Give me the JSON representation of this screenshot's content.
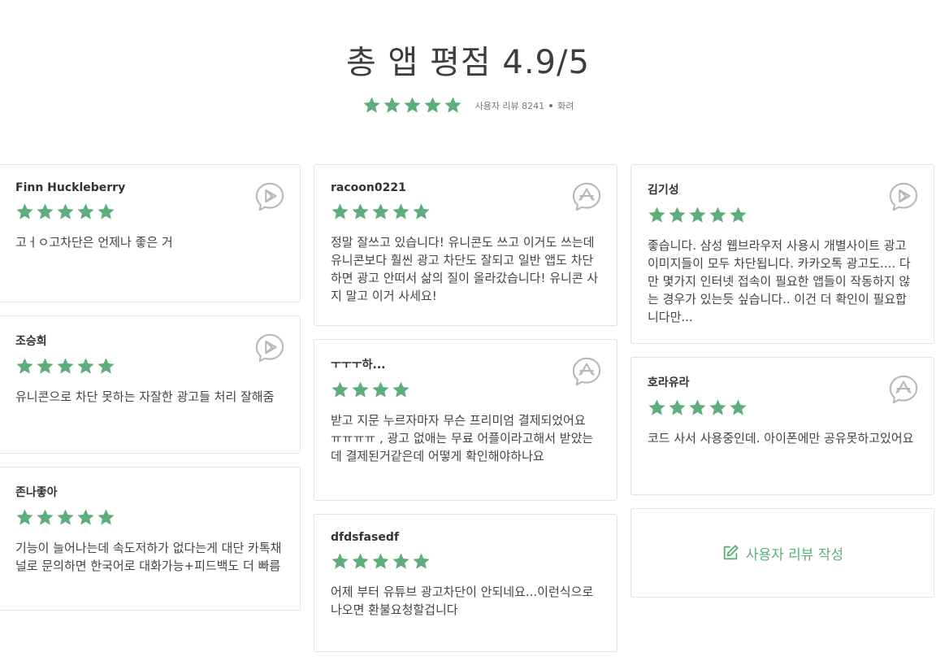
{
  "header": {
    "title": "총 앱 평점 4.9/5",
    "summary_stars": 5,
    "review_count_text": "사용자 리뷰 8241",
    "rating_word": "화려"
  },
  "colors": {
    "star": "#5dae7b",
    "store_icon": "#b8b8b8"
  },
  "reviews": [
    {
      "name": "Finn Huckleberry",
      "stars": 5,
      "store": "play-store-icon",
      "text": "고ㅓㅇ고차단은 언제나 좋은 거"
    },
    {
      "name": "조승희",
      "stars": 5,
      "store": "play-store-icon",
      "text": "유니콘으로 차단 못하는 자잘한 광고들 처리 잘해줌"
    },
    {
      "name": "존나좋아",
      "stars": 5,
      "store": "play-store-icon",
      "text": "기능이 늘어나는데 속도저하가 없다는게 대단 카톡채널로 문의하면 한국어로 대화가능+피드백도 더 빠름"
    },
    {
      "name": "racoon0221",
      "stars": 5,
      "store": "app-store-icon",
      "text": "정말 잘쓰고 있습니다! 유니콘도 쓰고 이거도 쓰는데 유니콘보다 훨씬 광고 차단도 잘되고 일반 앱도 차단하면 광고 안떠서 삶의 질이 올라갔습니다! 유니콘 사지 말고 이거 사세요!"
    },
    {
      "name": "ㅜㅜㅜ하...",
      "stars": 4,
      "store": "app-store-icon",
      "text": "받고 지문 누르자마자 무슨 프리미엄 결제되었어요 ㅠㅠㅠㅠ , 광고 없애는 무료 어플이라고해서 받았는데 결제된거같은데 어떻게 확인해야하나요"
    },
    {
      "name": "dfdsfasedf",
      "stars": 5,
      "store": "app-store-icon",
      "text": "어제 부터 유튜브 광고차단이 안되네요...이런식으로 나오면 환불요청할겁니다"
    },
    {
      "name": "김기성",
      "stars": 5,
      "store": "play-store-icon",
      "text": "좋습니다. 삼성 웹브라우저 사용시 개별사이트 광고 이미지들이 모두 차단됩니다. 카카오톡 광고도.... 다만 몇가지 인터넷 접속이 필요한 앱들이 작동하지 않는 경우가 있는듯 싶습니다.. 이건 더 확인이 필요합니다만..."
    },
    {
      "name": "호라유라",
      "stars": 5,
      "store": "app-store-icon",
      "text": "코드 사서 사용중인데. 아이폰에만 공유못하고있어요"
    }
  ],
  "write_review_label": "사용자 리뷰 작성"
}
